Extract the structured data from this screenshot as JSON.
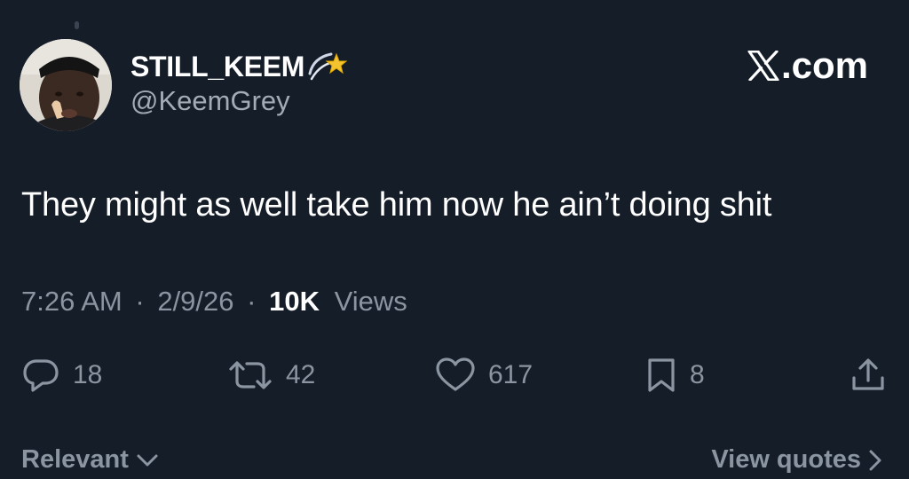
{
  "author": {
    "display_name": "STILL_KEEM",
    "name_emoji": "dizzy-star-emoji",
    "handle": "@KeemGrey",
    "avatar": "avatar-photo"
  },
  "brand": {
    "logo_text": ".com",
    "logo_icon": "x-logo-icon"
  },
  "tweet": {
    "text": "They might as well take him now he ain’t doing shit",
    "time": "7:26 AM",
    "separator": "·",
    "date": "2/9/26",
    "views_count": "10K",
    "views_label": "Views"
  },
  "actions": {
    "replies": "18",
    "reposts": "42",
    "likes": "617",
    "bookmarks": "8"
  },
  "footer": {
    "sort_label": "Relevant",
    "quotes_label": "View quotes"
  },
  "colors": {
    "background": "#151d29",
    "text_primary": "#ffffff",
    "text_secondary": "#8b95a1"
  }
}
